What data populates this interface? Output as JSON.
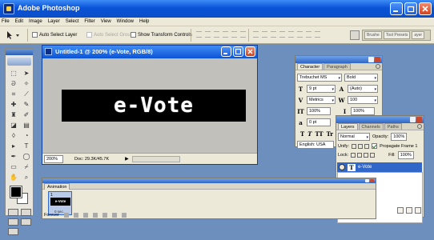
{
  "app": {
    "title": "Adobe Photoshop"
  },
  "menu": [
    "File",
    "Edit",
    "Image",
    "Layer",
    "Select",
    "Filter",
    "View",
    "Window",
    "Help"
  ],
  "options": {
    "auto_select_layer": "Auto Select Layer",
    "auto_select_groups": "Auto Select Groups",
    "show_transform": "Show Transform Controls",
    "wells": [
      "Brushe",
      "Tool Presets",
      "ayer"
    ]
  },
  "document": {
    "title": "Untitled-1 @ 200% (e-Vote, RGB/8)",
    "canvas_text": "e-Vote",
    "zoom": "200%",
    "info": "Doc: 29.3K/45.7K"
  },
  "character": {
    "tabs": [
      "Character",
      "Paragraph"
    ],
    "font": "Trebuchet MS",
    "style": "Bold",
    "size": "9 pt",
    "leading": "(Auto)",
    "kerning": "Metrics",
    "tracking": "100",
    "vscale": "100%",
    "hscale": "100%",
    "baseline": "0 pt",
    "language": "English: USA",
    "style_icons": [
      "T",
      "T",
      "TT",
      "Tr"
    ]
  },
  "layers": {
    "tabs": [
      "Layers",
      "Channels",
      "Paths"
    ],
    "blend": "Normal",
    "opacity_label": "Opacity:",
    "opacity": "100%",
    "unify_label": "Unify:",
    "propagate": "Propagate Frame 1",
    "lock_label": "Lock:",
    "fill_label": "Fill:",
    "fill": "100%",
    "layer_name": "e-Vote"
  },
  "animation": {
    "tab": "Animation",
    "frame_number": "1",
    "frame_thumb": "e-Vote",
    "frame_delay": "0 sec.",
    "loop": "Forever"
  }
}
